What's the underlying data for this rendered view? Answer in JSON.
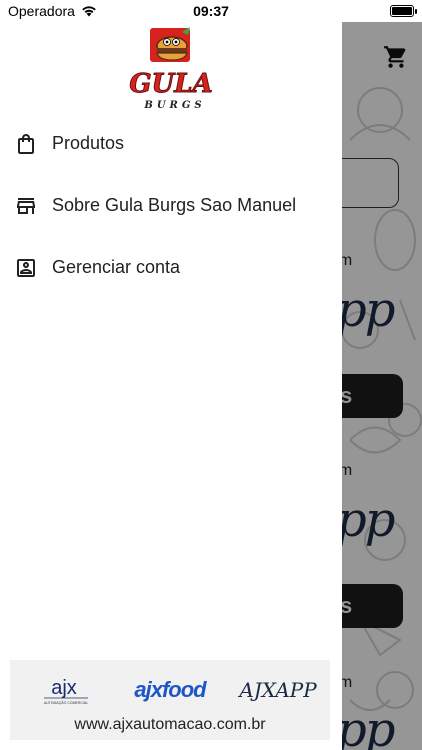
{
  "status_bar": {
    "carrier": "Operadora",
    "time": "09:37",
    "battery_level": 1.0
  },
  "logo": {
    "brand_main": "GULA",
    "brand_sub": "BURGS"
  },
  "drawer": {
    "items": [
      {
        "label": "Produtos",
        "icon": "shopping-bag-icon"
      },
      {
        "label": "Sobre Gula Burgs Sao Manuel",
        "icon": "storefront-icon"
      },
      {
        "label": "Gerenciar conta",
        "icon": "account-box-icon"
      }
    ]
  },
  "footer": {
    "logos": [
      "ajx",
      "ajxfood",
      "AJXAPP"
    ],
    "logo_tagline": "AUTOMAÇÃO COMERCIAL",
    "url": "www.ajxautomacao.com.br"
  },
  "background": {
    "text_fragments": [
      "em",
      "em",
      "em"
    ],
    "app_word_fragments": [
      "pp",
      "pp",
      "pp"
    ],
    "button_fragments": [
      "s",
      "s"
    ]
  },
  "colors": {
    "drawer_bg": "#ffffff",
    "scrim": "rgba(0,0,0,0.38)",
    "footer_bg": "#f1f1f1",
    "logo_red": "#d8221e",
    "ajxfood_blue": "#1f56c7",
    "ajx_navy": "#1b2a44"
  }
}
